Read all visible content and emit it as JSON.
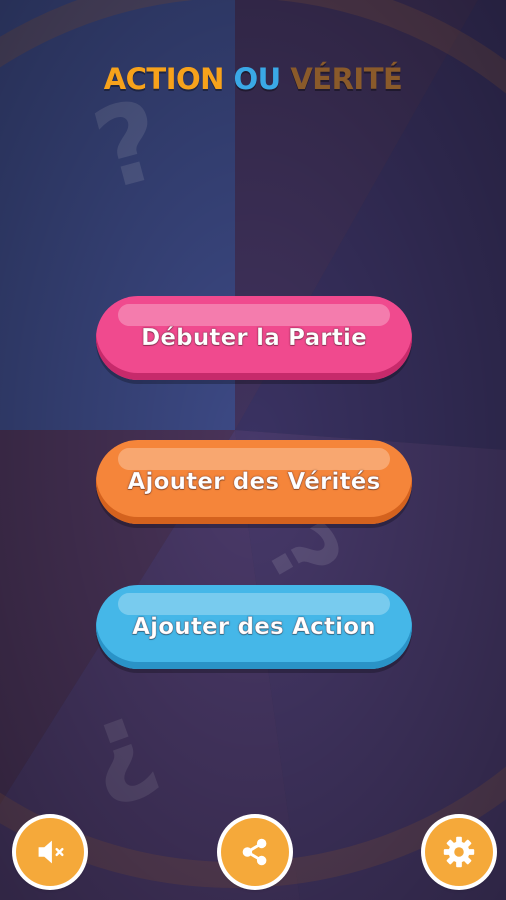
{
  "title": {
    "word1": "ACTION",
    "word2": "OU",
    "word3": "VÉRITÉ",
    "colors": {
      "word1": "#f7a21b",
      "word2": "#3aa8e6",
      "word3": "#8a5a2a"
    }
  },
  "buttons": {
    "start": "Débuter la Partie",
    "add_truths": "Ajouter des Vérités",
    "add_actions": "Ajouter des Action"
  },
  "bottom_bar": {
    "sound_icon": "speaker-muted-icon",
    "share_icon": "share-icon",
    "settings_icon": "gear-icon"
  },
  "colors": {
    "accent_pink": "#f04a8e",
    "accent_orange": "#f5853a",
    "accent_blue": "#45b7e8",
    "round_button": "#f5a93a"
  }
}
